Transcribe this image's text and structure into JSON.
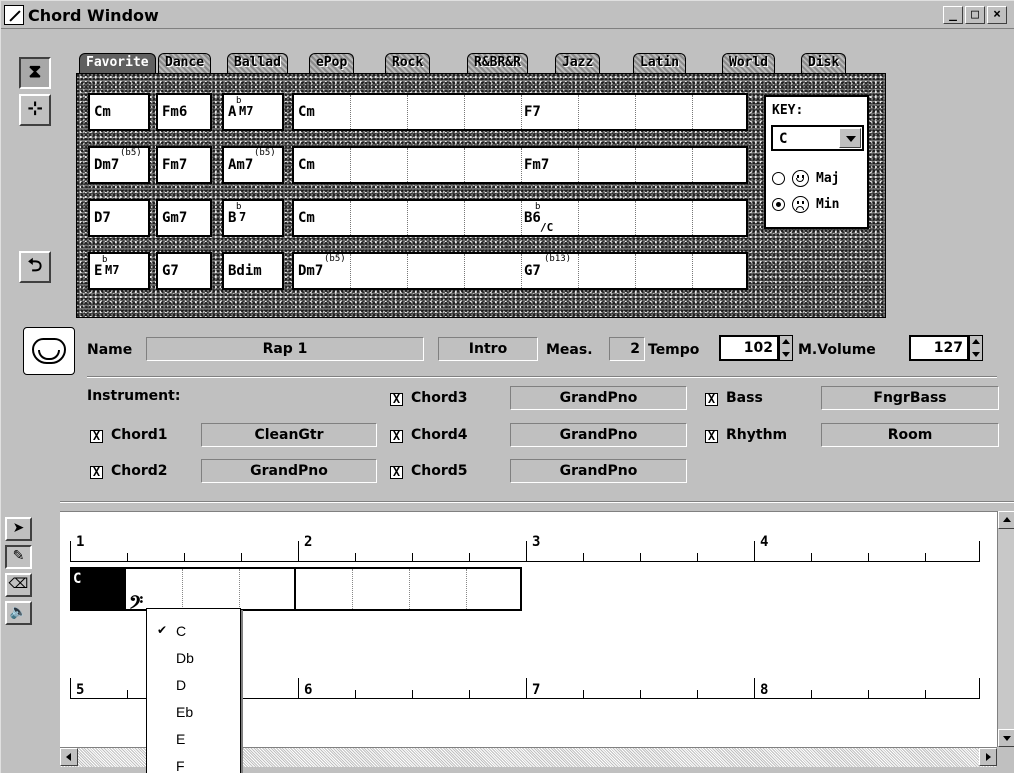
{
  "window": {
    "title": "Chord Window",
    "controls": [
      "_",
      "□",
      "×"
    ]
  },
  "tabs": [
    "Favorite",
    "Dance",
    "Ballad",
    "ePop",
    "Rock",
    "R&BR&R",
    "Jazz",
    "Latin",
    "World",
    "Disk"
  ],
  "active_tab": "Favorite",
  "chord_palette": {
    "rows": [
      {
        "c1": "Cm",
        "c2": "Fm6",
        "c3": "A",
        "c3_sup": "b",
        "c3_sub": "M7",
        "wide1": "Cm",
        "wide2": "F7"
      },
      {
        "c1": "Dm7",
        "c1_sup": "(b5)",
        "c2": "Fm7",
        "c3": "Am7",
        "c3_sup": "(b5)",
        "wide1": "Cm",
        "wide2": "Fm7"
      },
      {
        "c1": "D7",
        "c2": "Gm7",
        "c3": "B",
        "c3_sup": "b",
        "c3_sub": "7",
        "wide1": "Cm",
        "wide2": "B6",
        "wide2_sup": "b",
        "wide2_slash": "/C"
      },
      {
        "c1": "E",
        "c1_sup": "b",
        "c1_sub": "M7",
        "c2": "G7",
        "c3": "Bdim",
        "wide1": "Dm7",
        "wide1_sup": "(b5)",
        "wide2": "G7",
        "wide2_sup": "(b13)"
      }
    ]
  },
  "key_panel": {
    "label": "KEY:",
    "value": "C",
    "maj_label": "Maj",
    "min_label": "Min",
    "selected": "Min"
  },
  "style": {
    "name_label": "Name",
    "name_value": "Rap 1",
    "section": "Intro",
    "meas_label": "Meas.",
    "meas_value": "2",
    "tempo_label": "Tempo",
    "tempo_value": "102",
    "mvolume_label": "M.Volume",
    "mvolume_value": "127"
  },
  "instruments": {
    "label": "Instrument:",
    "chord1": {
      "label": "Chord1",
      "checked": true,
      "value": "CleanGtr"
    },
    "chord2": {
      "label": "Chord2",
      "checked": true,
      "value": "GrandPno"
    },
    "chord3": {
      "label": "Chord3",
      "checked": true,
      "value": "GrandPno"
    },
    "chord4": {
      "label": "Chord4",
      "checked": true,
      "value": "GrandPno"
    },
    "chord5": {
      "label": "Chord5",
      "checked": true,
      "value": "GrandPno"
    },
    "bass": {
      "label": "Bass",
      "checked": true,
      "value": "FngrBass"
    },
    "rhythm": {
      "label": "Rhythm",
      "checked": true,
      "value": "Room"
    },
    "check_mark": "X"
  },
  "song": {
    "measures_row1": [
      "1",
      "2",
      "3",
      "4"
    ],
    "measures_row2": [
      "5",
      "6",
      "7",
      "8"
    ],
    "first_chord": "C",
    "bass_clef": "𝄢"
  },
  "popup_menu": {
    "items": [
      "C",
      "Db",
      "D",
      "Eb",
      "E",
      "F"
    ],
    "checked": "C",
    "check_glyph": "✔"
  }
}
